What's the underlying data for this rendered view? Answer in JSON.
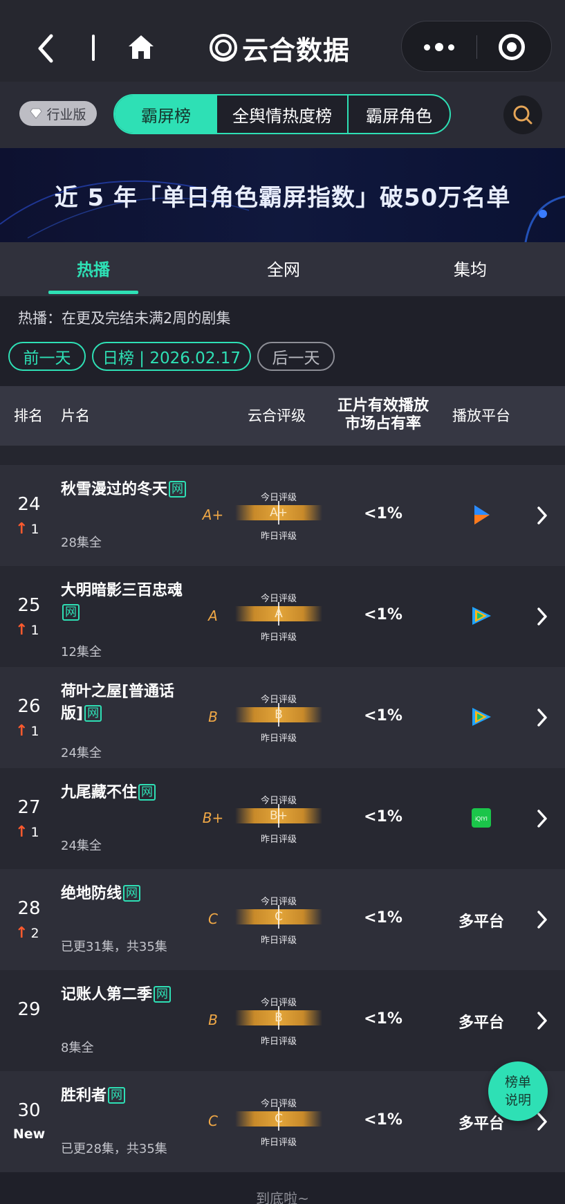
{
  "nav": {
    "title": "云合数据",
    "icons": {
      "back": "back-icon",
      "home": "home-icon",
      "more": "more-icon",
      "close": "close-icon"
    }
  },
  "header": {
    "edition_label": "行业版",
    "segments": [
      "霸屏榜",
      "全舆情热度榜",
      "霸屏角色"
    ],
    "active_segment": "霸屏榜"
  },
  "banner": {
    "text": "近 5 年「单日角色霸屏指数」破50万名单"
  },
  "subtabs": {
    "items": [
      "热播",
      "全网",
      "集均"
    ],
    "active": "热播"
  },
  "description": "热播：在更及完结未满2周的剧集",
  "date_controls": {
    "prev": "前一天",
    "current": "日榜 | 2026.02.17",
    "next": "后一天"
  },
  "table": {
    "headers": {
      "rank": "排名",
      "title": "片名",
      "rating": "云合评级",
      "share_line1": "正片有效播放",
      "share_line2": "市场占有率",
      "platform": "播放平台"
    },
    "gauge_labels": {
      "today": "今日评级",
      "yesterday": "昨日评级"
    },
    "net_badge": "网",
    "rows": [
      {
        "rank": "24",
        "change": "1",
        "is_new": false,
        "title": "秋雪漫过的冬天",
        "episodes": "28集全",
        "grade": "A+",
        "share": "<1%",
        "platform": "tencent-video-blue",
        "platform_text": ""
      },
      {
        "rank": "25",
        "change": "1",
        "is_new": false,
        "title": "大明暗影三百忠魂",
        "episodes": "12集全",
        "grade": "A",
        "share": "<1%",
        "platform": "tencent-video",
        "platform_text": ""
      },
      {
        "rank": "26",
        "change": "1",
        "is_new": false,
        "title": "荷叶之屋[普通话版]",
        "episodes": "24集全",
        "grade": "B",
        "share": "<1%",
        "platform": "tencent-video",
        "platform_text": ""
      },
      {
        "rank": "27",
        "change": "1",
        "is_new": false,
        "title": "九尾藏不住",
        "episodes": "24集全",
        "grade": "B+",
        "share": "<1%",
        "platform": "iqiyi",
        "platform_text": ""
      },
      {
        "rank": "28",
        "change": "2",
        "is_new": false,
        "title": "绝地防线",
        "episodes": "已更31集，共35集",
        "grade": "C",
        "share": "<1%",
        "platform": "multi",
        "platform_text": "多平台"
      },
      {
        "rank": "29",
        "change": "",
        "is_new": false,
        "title": "记账人第二季",
        "episodes": "8集全",
        "grade": "B",
        "share": "<1%",
        "platform": "multi",
        "platform_text": "多平台"
      },
      {
        "rank": "30",
        "change": "New",
        "is_new": true,
        "title": "胜利者",
        "episodes": "已更28集，共35集",
        "grade": "C",
        "share": "<1%",
        "platform": "multi",
        "platform_text": "多平台"
      }
    ]
  },
  "help_button": {
    "line1": "榜单",
    "line2": "说明"
  },
  "footer": "到底啦~",
  "colors": {
    "accent": "#2ee0b5",
    "grade": "#f0a846",
    "rise": "#ff5a2e",
    "bg": "#1f2029"
  }
}
